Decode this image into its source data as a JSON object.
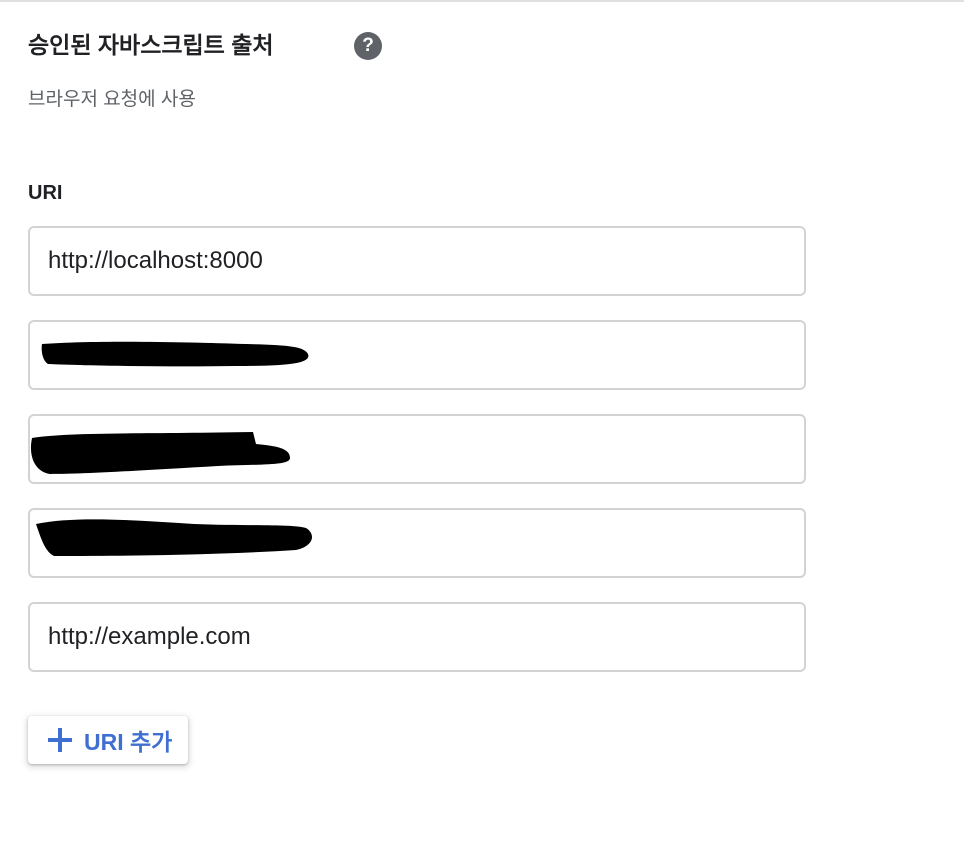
{
  "section": {
    "title": "승인된 자바스크립트 출처",
    "help_glyph": "?",
    "subtitle": "브라우저 요청에 사용"
  },
  "uri_label": "URI",
  "uris": [
    {
      "value": "http://localhost:8000",
      "redacted": false
    },
    {
      "value": "",
      "redacted": true
    },
    {
      "value": "",
      "redacted": true
    },
    {
      "value": "",
      "redacted": true
    },
    {
      "value": "http://example.com",
      "redacted": false
    }
  ],
  "add_button": {
    "label": "URI 추가",
    "icon": "plus-icon"
  },
  "colors": {
    "accent": "#3f6fd0",
    "field_border": "#d3d3d3",
    "help_icon_bg": "#5f6368",
    "redaction": "#000000"
  }
}
